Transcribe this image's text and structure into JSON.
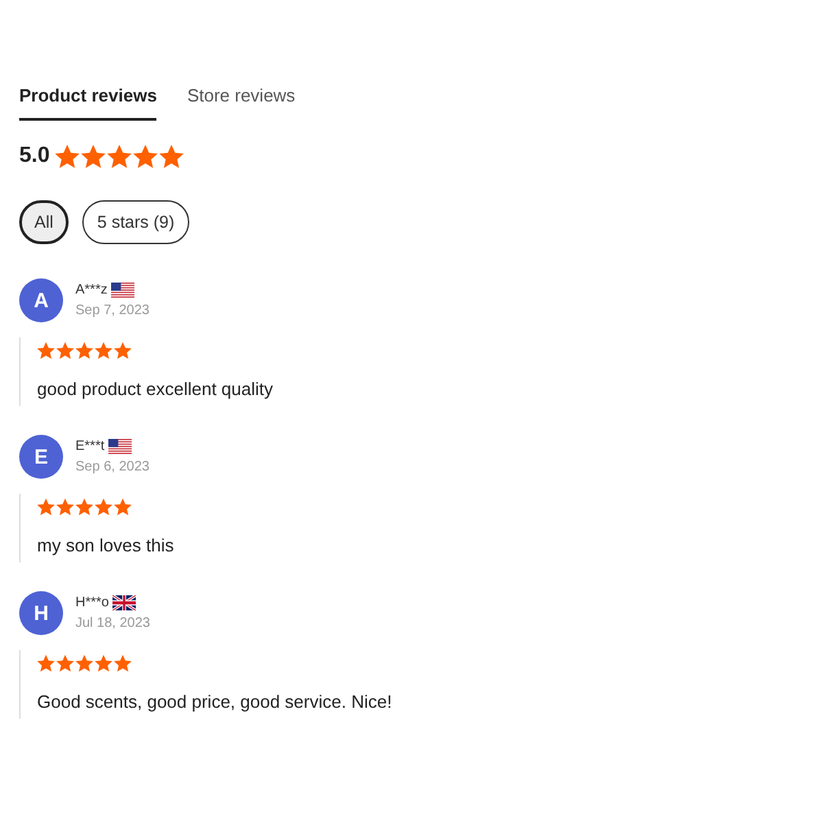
{
  "tabs": [
    {
      "label": "Product reviews",
      "selected": true
    },
    {
      "label": "Store reviews",
      "selected": false
    }
  ],
  "rating": {
    "score": "5.0",
    "stars": 5
  },
  "filters": [
    {
      "label": "All",
      "selected": true
    },
    {
      "label": "5 stars (9)",
      "selected": false
    }
  ],
  "reviews": [
    {
      "initial": "A",
      "name": "A***z",
      "flag": {
        "kind": "us"
      },
      "date": "Sep 7, 2023",
      "stars": 5,
      "text": "good product excellent quality"
    },
    {
      "initial": "E",
      "name": "E***t",
      "flag": {
        "kind": "us"
      },
      "date": "Sep 6, 2023",
      "stars": 5,
      "text": "my son loves this"
    },
    {
      "initial": "H",
      "name": "H***o",
      "flag": {
        "kind": "uk"
      },
      "date": "Jul 18, 2023",
      "stars": 5,
      "text": "Good scents, good price, good service. Nice!"
    }
  ]
}
